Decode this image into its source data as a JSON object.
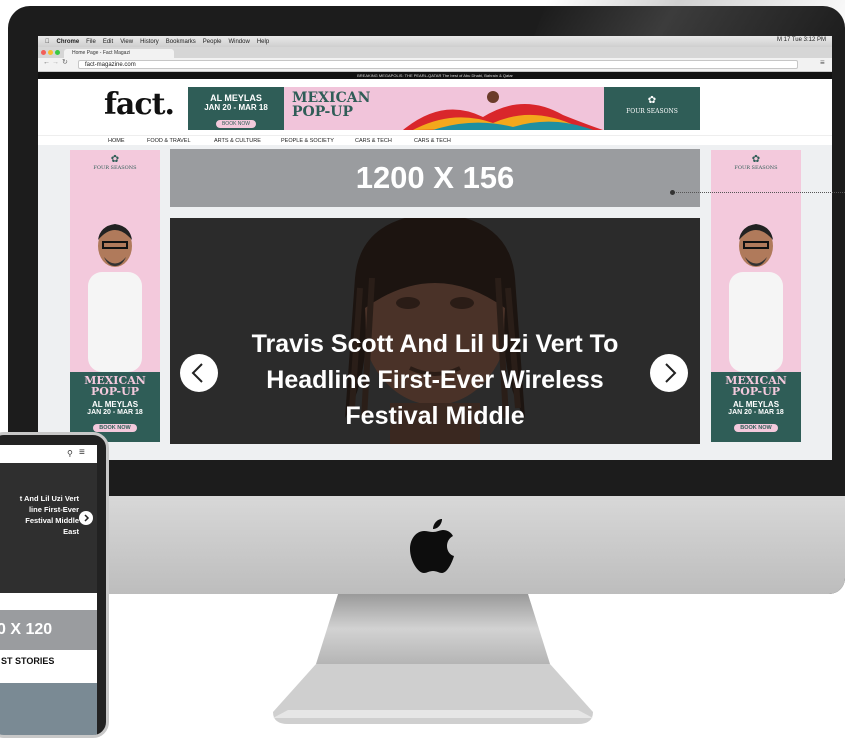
{
  "menubar": {
    "apple": "",
    "items": [
      "Chrome",
      "File",
      "Edit",
      "View",
      "History",
      "Bookmarks",
      "People",
      "Window",
      "Help"
    ],
    "status": "M 17  Tue 3:12 PM"
  },
  "browser": {
    "tab_title": "Home Page - Fact Magazi",
    "url": "fact-magazine.com"
  },
  "site": {
    "top_strip": "BREAKING  MEGAPOLIS: THE PEARL-QATAR                         The best of Abu Dhabi, Bahrain & Qatar",
    "logo": "fact.",
    "banner": {
      "venue": "AL MEYLAS",
      "dates": "JAN 20 - MAR 18",
      "cta": "BOOK NOW",
      "headline_1": "MEXICAN",
      "headline_2": "POP-UP",
      "brand": "FOUR SEASONS"
    },
    "nav": [
      "HOME",
      "FOOD & TRAVEL",
      "ARTS & CULTURE",
      "PEOPLE & SOCIETY",
      "CARS & TECH",
      "CARS & TECH"
    ],
    "side_ad": {
      "brand": "FOUR SEASONS",
      "headline_1": "MEXICAN",
      "headline_2": "POP-UP",
      "venue": "AL MEYLAS",
      "dates": "JAN 20 - MAR 18",
      "cta": "BOOK NOW"
    },
    "ad_slot": "1200 X 156",
    "slide_title": "Travis Scott And Lil Uzi Vert To Headline First-Ever Wireless Festival Middle"
  },
  "phone": {
    "slide_text": "t And Lil Uzi Vert\nline First-Ever\nFestival Middle\nEast",
    "ad_slot": "0 X 120",
    "section": "ST STORIES"
  }
}
